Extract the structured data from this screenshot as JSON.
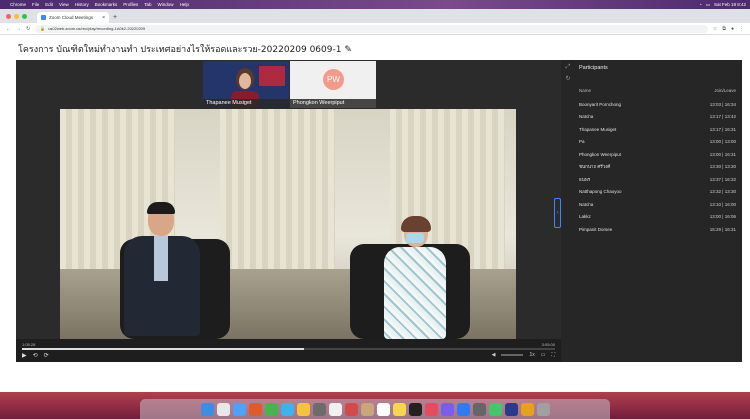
{
  "menubar": {
    "items": [
      "Chrome",
      "File",
      "Edit",
      "View",
      "History",
      "Bookmarks",
      "Profiles",
      "Tab",
      "Window",
      "Help"
    ],
    "right": [
      "Sat Feb 19 8:42"
    ]
  },
  "browser": {
    "tab_title": "Zoom Cloud Meetings",
    "url": "us02web.zoom.us/rec/play/recording-1A0k2-20220209"
  },
  "page": {
    "title": "โครงการ บัณฑิตใหม่ทำงานทำ ประเทศอย่างไรให้รอดและรวย-20220209 0609-1 ✎",
    "edit_icon": "pencil-icon"
  },
  "thumbnails": [
    {
      "name": "Thapanee Musiget",
      "initials": ""
    },
    {
      "name": "Phongkon Weerpiput",
      "initials": "PW"
    }
  ],
  "player": {
    "time_current": "1:05:28",
    "time_total": "3:05:00",
    "progress": 0.53,
    "speed_label": "1x"
  },
  "participants": {
    "title": "Participants",
    "col_name": "Name",
    "col_time": "Join/Leave",
    "rows": [
      {
        "name": "Boonyarit Pornchong",
        "time": "13:03 | 16:34"
      },
      {
        "name": "Natcha",
        "time": "13:17 | 13:42"
      },
      {
        "name": "Thapanee Musiget",
        "time": "13:17 | 16:31"
      },
      {
        "name": "Pa",
        "time": "13:00 | 13:00"
      },
      {
        "name": "Phongkon Weerpiput",
        "time": "13:00 | 16:31"
      },
      {
        "name": "ชนกนาถ ศรีวงศ์",
        "time": "13:30 | 13:30"
      },
      {
        "name": "ธนพร",
        "time": "13:37 | 16:32"
      },
      {
        "name": "Natthapong Chaoyoo",
        "time": "13:32 | 13:30"
      },
      {
        "name": "Natcha",
        "time": "13:10 | 16:00"
      },
      {
        "name": "Lakkz",
        "time": "13:00 | 16:06"
      },
      {
        "name": "Pimpanit Dorsee",
        "time": "15:29 | 16:31"
      }
    ]
  },
  "dock": {
    "icon_colors": [
      "#3a8ee6",
      "#e8e8e8",
      "#4aa3ff",
      "#e05a2a",
      "#45b649",
      "#3ab3f0",
      "#f7c23c",
      "#6c6c6c",
      "#f0f0f0",
      "#d24a4a",
      "#c9a67b",
      "#ffffff",
      "#f6d74a",
      "#222222",
      "#e84a5f",
      "#7a5cf0",
      "#2f7bf5",
      "#666666",
      "#41c86b",
      "#2a3a8e",
      "#e8a21a",
      "#a0a0a0"
    ]
  }
}
